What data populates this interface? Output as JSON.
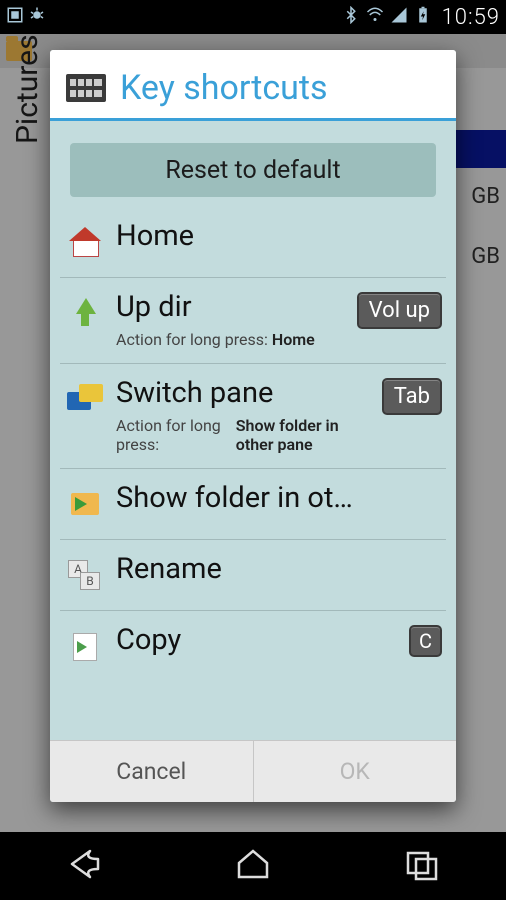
{
  "statusbar": {
    "clock": "10:59"
  },
  "background": {
    "side_label": "Pictures",
    "right_text_1": "GB",
    "right_text_2": "GB"
  },
  "dialog": {
    "title": "Key shortcuts",
    "reset_label": "Reset to default",
    "long_press_prefix": "Action for long press:",
    "items": [
      {
        "label": "Home",
        "icon": "home-icon",
        "key": "",
        "long_press": ""
      },
      {
        "label": "Up dir",
        "icon": "up-arrow-icon",
        "key": "Vol up",
        "long_press": "Home"
      },
      {
        "label": "Switch pane",
        "icon": "panes-icon",
        "key": "Tab",
        "long_press": "Show folder in other pane"
      },
      {
        "label": "Show folder in ot…",
        "icon": "folder-arrow-icon",
        "key": "",
        "long_press": ""
      },
      {
        "label": "Rename",
        "icon": "rename-icon",
        "key": "",
        "long_press": ""
      },
      {
        "label": "Copy",
        "icon": "copy-icon",
        "key": "C",
        "long_press": ""
      }
    ],
    "footer": {
      "cancel": "Cancel",
      "ok": "OK"
    }
  }
}
